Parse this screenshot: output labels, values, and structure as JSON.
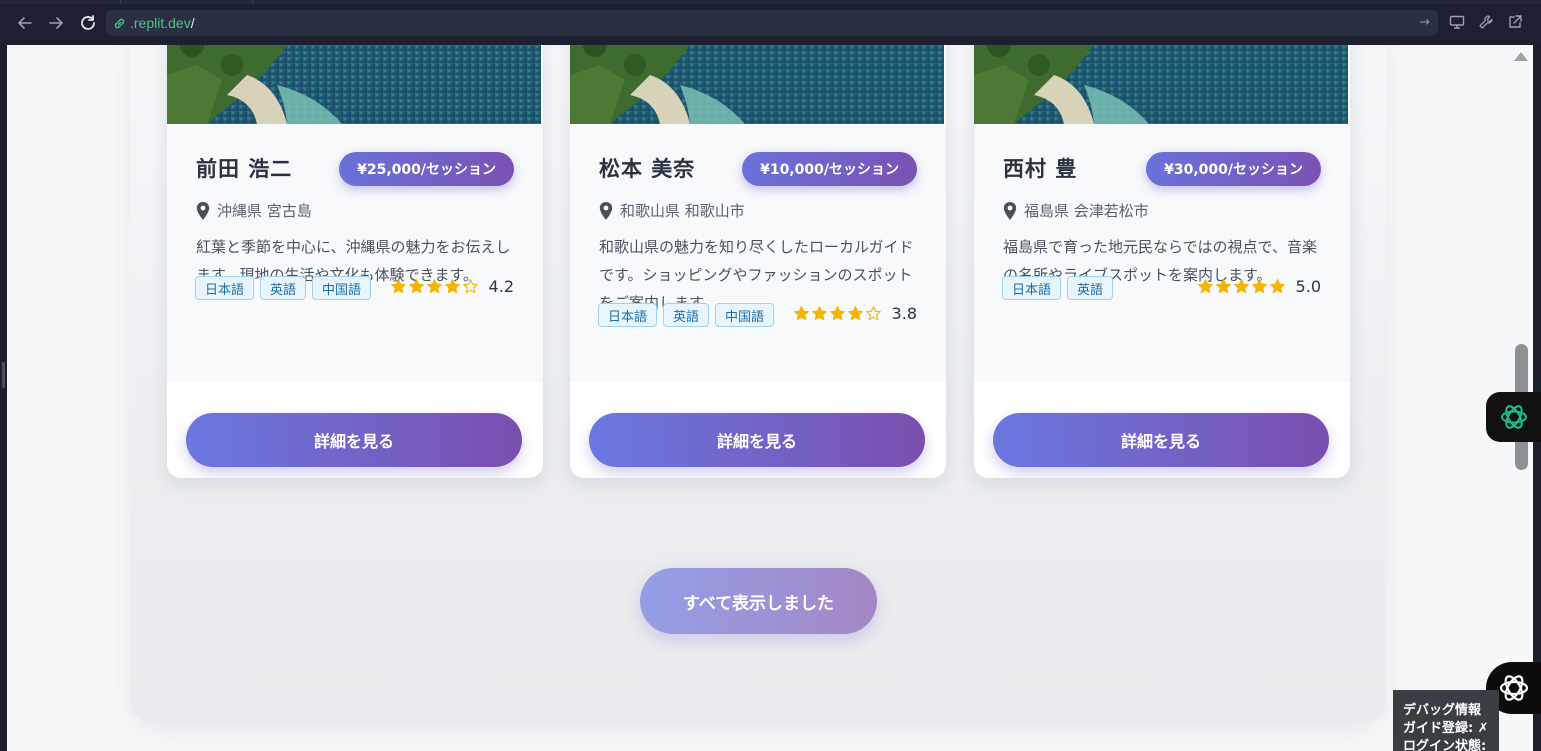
{
  "browser": {
    "url_host": ".replit.dev",
    "url_path": "/"
  },
  "guides": [
    {
      "name": "前田 浩二",
      "price": "¥25,000/セッション",
      "location": "沖縄県 宮古島",
      "description": "紅葉と季節を中心に、沖縄県の魅力をお伝えします。現地の生活や文化も体験できます。",
      "languages": [
        "日本語",
        "英語",
        "中国語"
      ],
      "rating": "4.2",
      "rating_value": 4.2,
      "cta": "詳細を見る"
    },
    {
      "name": "松本 美奈",
      "price": "¥10,000/セッション",
      "location": "和歌山県 和歌山市",
      "description": "和歌山県の魅力を知り尽くしたローカルガイドです。ショッピングやファッションのスポットをご案内します。",
      "languages": [
        "日本語",
        "英語",
        "中国語"
      ],
      "rating": "3.8",
      "rating_value": 3.8,
      "cta": "詳細を見る"
    },
    {
      "name": "西村 豊",
      "price": "¥30,000/セッション",
      "location": "福島県 会津若松市",
      "description": "福島県で育った地元民ならではの視点で、音楽の名所やライブスポットを案内します。",
      "languages": [
        "日本語",
        "英語"
      ],
      "rating": "5.0",
      "rating_value": 5.0,
      "cta": "詳細を見る"
    }
  ],
  "show_all_label": "すべて表示しました",
  "debug": {
    "title": "デバッグ情報",
    "line1": "ガイド登録: ✗",
    "line2": "ログイン状態: ✗"
  },
  "colors": {
    "accent_start": "#6a78e0",
    "accent_end": "#7a4fae",
    "star": "#f5b400",
    "tag_bg": "#e8f5fd",
    "tag_text": "#1b6fa6"
  }
}
